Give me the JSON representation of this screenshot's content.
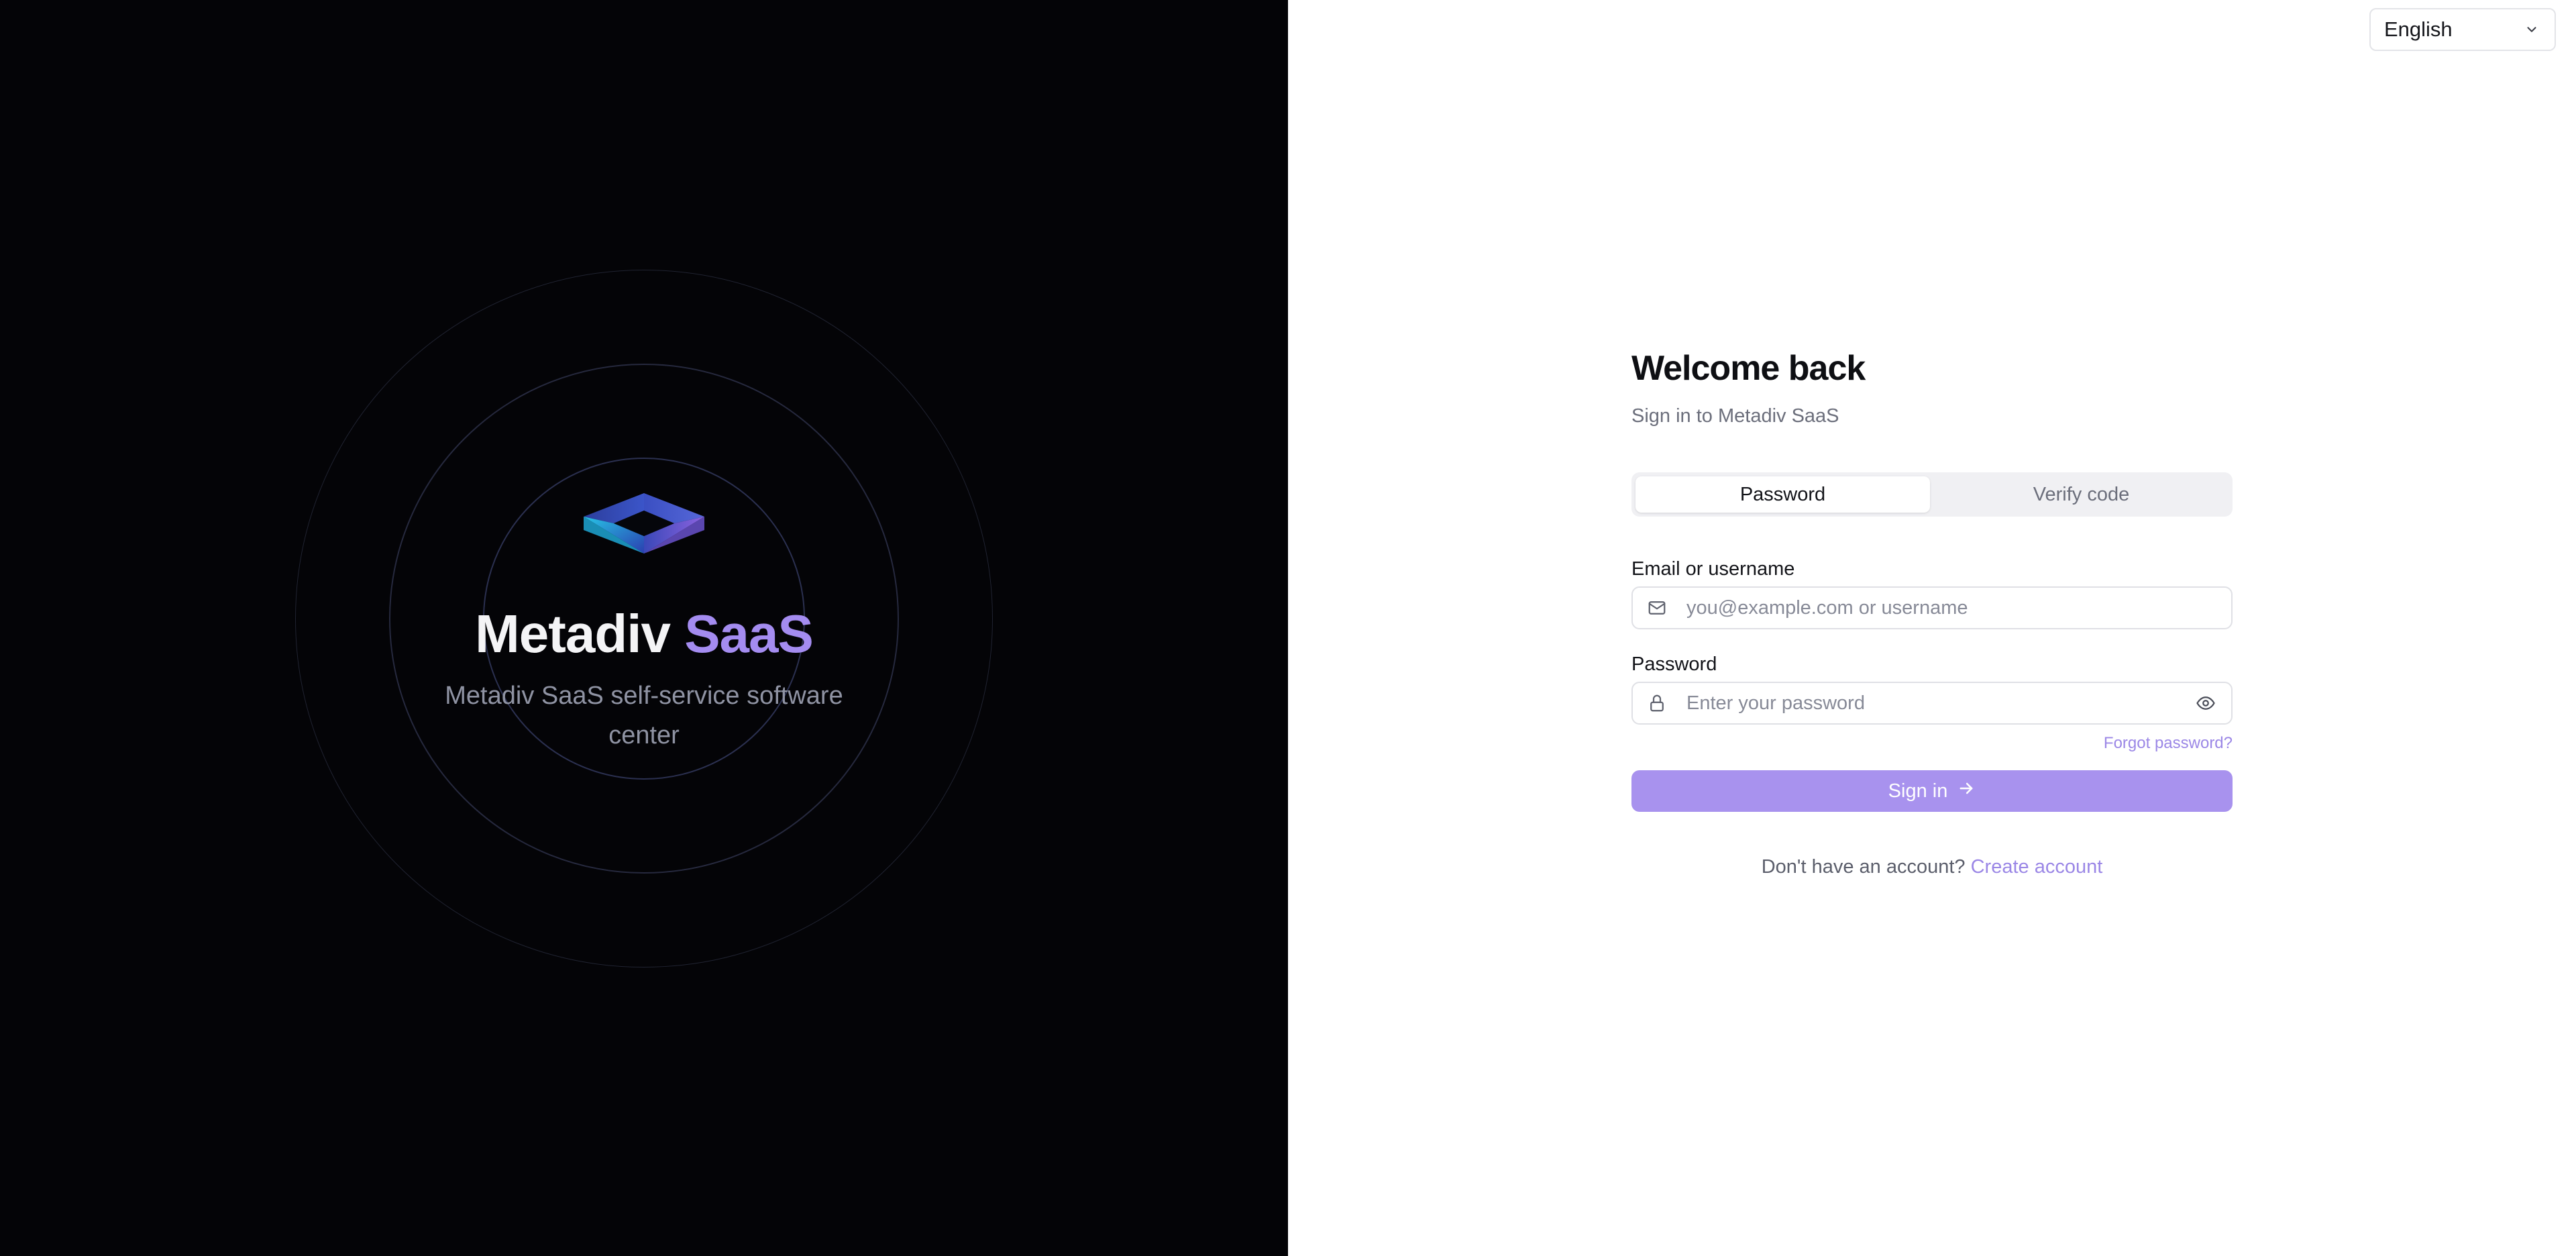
{
  "language": {
    "selected": "English"
  },
  "brand": {
    "name_main": "Metadiv",
    "name_accent": "SaaS",
    "tagline": "Metadiv SaaS self-service software center",
    "accent_color": "#a48cf0"
  },
  "form": {
    "title": "Welcome back",
    "subtitle": "Sign in to Metadiv SaaS",
    "tabs": [
      {
        "label": "Password",
        "active": true
      },
      {
        "label": "Verify code",
        "active": false
      }
    ],
    "email": {
      "label": "Email or username",
      "placeholder": "you@example.com or username",
      "value": ""
    },
    "password": {
      "label": "Password",
      "placeholder": "Enter your password",
      "value": ""
    },
    "forgot_label": "Forgot password?",
    "submit_label": "Sign in",
    "signup_prompt": "Don't have an account?",
    "signup_link": "Create account",
    "primary_color": "#a892ee"
  },
  "icons": {
    "language_dropdown": "chevron-down-icon",
    "email_field": "mail-icon",
    "password_field": "lock-icon",
    "password_toggle": "eye-icon",
    "submit": "arrow-right-icon",
    "logo": "diamond-prism-logo"
  }
}
